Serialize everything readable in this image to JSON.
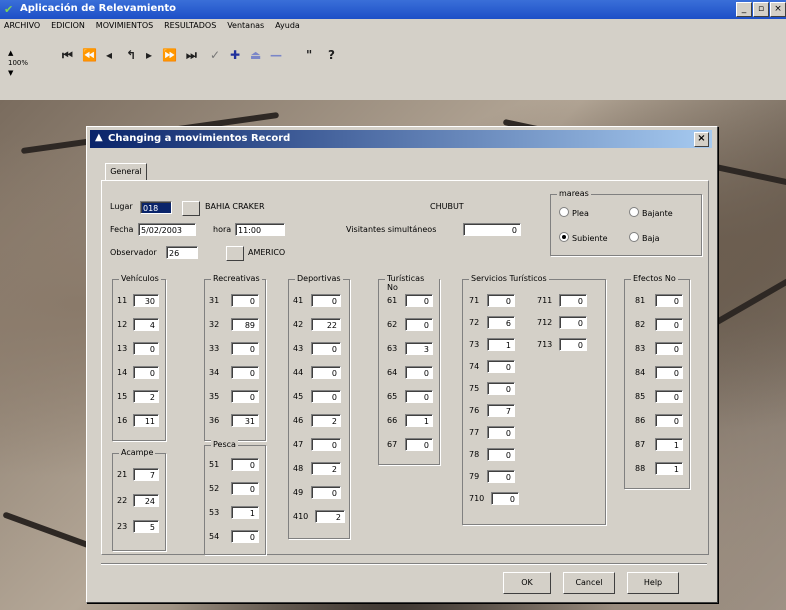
{
  "app": {
    "title": "Aplicación de Relevamiento"
  },
  "window_buttons": [
    "_",
    "8",
    "x"
  ],
  "menu": [
    "ARCHIVO",
    "EDICION",
    "MOVIMIENTOS",
    "RESULTADOS",
    "Ventanas",
    "Ayuda"
  ],
  "toolbar": {
    "zoom_label": "100%",
    "buttons": [
      "H",
      "◀◀",
      "◀",
      "↰",
      "▶",
      "▶▶",
      "▶I",
      "✓",
      "✚",
      "△",
      "—",
      "\"",
      "?"
    ],
    "icons": [
      "first-record-icon",
      "prev-page-icon",
      "prev-record-icon",
      "undo-icon",
      "next-record-icon",
      "next-page-icon",
      "last-record-icon",
      "check-icon",
      "add-record-icon",
      "eject-icon",
      "delete-icon",
      "quote-icon",
      "help-icon"
    ]
  },
  "dialog": {
    "title": "Changing a movimientos Record",
    "tab": "General",
    "lugar_label": "Lugar",
    "lugar_value": "018",
    "lugar_name": "BAHIA CRAKER",
    "province": "CHUBUT",
    "fecha_label": "Fecha",
    "fecha_value": "5/02/2003",
    "hora_label": "hora",
    "hora_value": "11:00",
    "visitantes_label": "Visitantes simultáneos",
    "visitantes_value": "0",
    "observador_label": "Observador",
    "observador_value": "26",
    "observador_name": "AMERICO",
    "mareas": {
      "title": "mareas",
      "options": [
        {
          "label": "Plea",
          "checked": false
        },
        {
          "label": "Bajante",
          "checked": false
        },
        {
          "label": "Subiente",
          "checked": true
        },
        {
          "label": "Baja",
          "checked": false
        }
      ]
    },
    "vehiculos": {
      "title": "Vehículos",
      "rows": [
        [
          "11",
          "30"
        ],
        [
          "12",
          "4"
        ],
        [
          "13",
          "0"
        ],
        [
          "14",
          "0"
        ],
        [
          "15",
          "2"
        ],
        [
          "16",
          "11"
        ]
      ]
    },
    "acampe": {
      "title": "Acampe",
      "rows": [
        [
          "21",
          "7"
        ],
        [
          "22",
          "24"
        ],
        [
          "23",
          "5"
        ]
      ]
    },
    "recreativas": {
      "title": "Recreativas",
      "rows": [
        [
          "31",
          "0"
        ],
        [
          "32",
          "89"
        ],
        [
          "33",
          "0"
        ],
        [
          "34",
          "0"
        ],
        [
          "35",
          "0"
        ],
        [
          "36",
          "31"
        ]
      ]
    },
    "pesca": {
      "title": "Pesca",
      "rows": [
        [
          "51",
          "0"
        ],
        [
          "52",
          "0"
        ],
        [
          "53",
          "1"
        ],
        [
          "54",
          "0"
        ]
      ]
    },
    "deportivas": {
      "title": "Deportivas",
      "rows": [
        [
          "41",
          "0"
        ],
        [
          "42",
          "22"
        ],
        [
          "43",
          "0"
        ],
        [
          "44",
          "0"
        ],
        [
          "45",
          "0"
        ],
        [
          "46",
          "2"
        ],
        [
          "47",
          "0"
        ],
        [
          "48",
          "2"
        ],
        [
          "49",
          "0"
        ],
        [
          "410",
          "2"
        ]
      ]
    },
    "turisticas": {
      "title": "Turísticas No",
      "rows": [
        [
          "61",
          "0"
        ],
        [
          "62",
          "0"
        ],
        [
          "63",
          "3"
        ],
        [
          "64",
          "0"
        ],
        [
          "65",
          "0"
        ],
        [
          "66",
          "1"
        ],
        [
          "67",
          "0"
        ]
      ]
    },
    "servicios": {
      "title": "Servicios Turísticos",
      "rows": [
        [
          "71",
          "0"
        ],
        [
          "72",
          "6"
        ],
        [
          "73",
          "1"
        ],
        [
          "74",
          "0"
        ],
        [
          "75",
          "0"
        ],
        [
          "76",
          "7"
        ],
        [
          "77",
          "0"
        ],
        [
          "78",
          "0"
        ],
        [
          "79",
          "0"
        ],
        [
          "710",
          "0"
        ]
      ],
      "rows2": [
        [
          "711",
          "0"
        ],
        [
          "712",
          "0"
        ],
        [
          "713",
          "0"
        ]
      ]
    },
    "efectos": {
      "title": "Efectos No",
      "rows": [
        [
          "81",
          "0"
        ],
        [
          "82",
          "0"
        ],
        [
          "83",
          "0"
        ],
        [
          "84",
          "0"
        ],
        [
          "85",
          "0"
        ],
        [
          "86",
          "0"
        ],
        [
          "87",
          "1"
        ],
        [
          "88",
          "1"
        ]
      ]
    },
    "buttons": {
      "ok": "OK",
      "cancel": "Cancel",
      "help": "Help"
    }
  }
}
